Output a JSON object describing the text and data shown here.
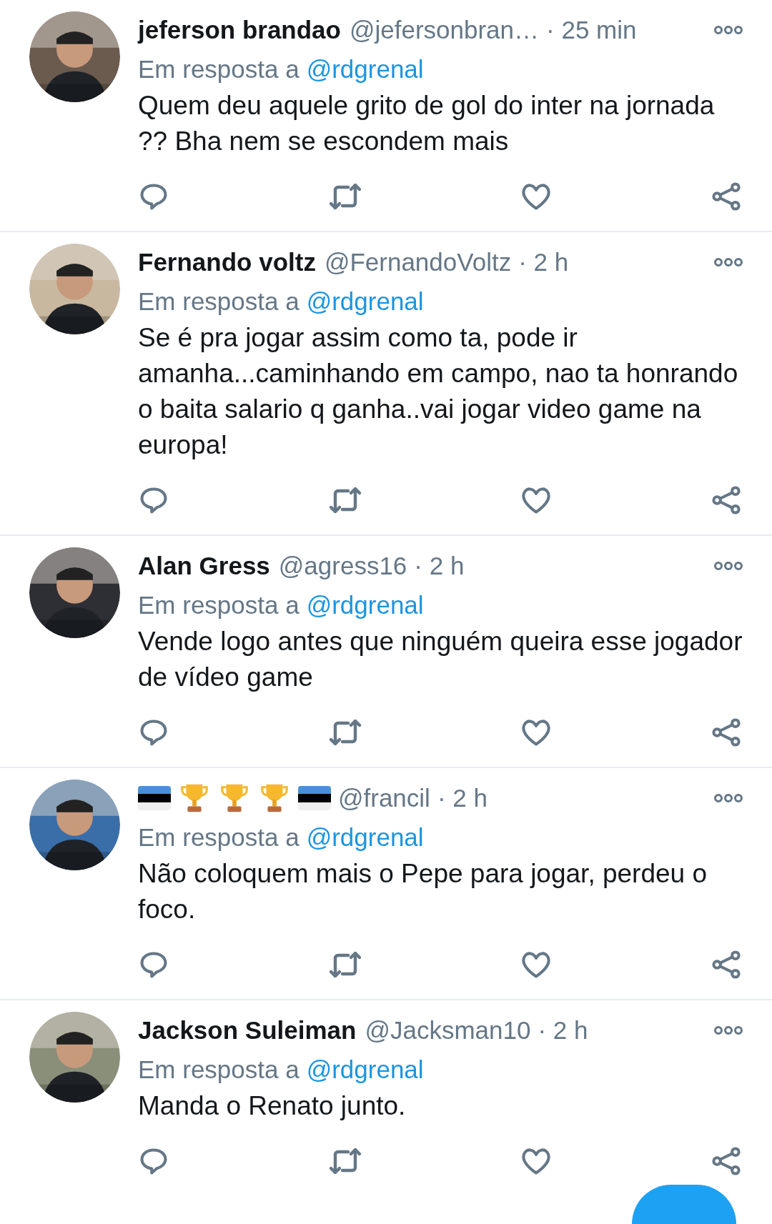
{
  "tweets": [
    {
      "name": "jeferson brandao",
      "handle": "@jefersonbran…",
      "time": "· 25 min",
      "reply_prefix": "Em resposta a",
      "reply_to": "@rdgrenal",
      "text": "Quem deu aquele grito de gol do inter na jornada ?? Bha nem se escondem mais"
    },
    {
      "name": "Fernando voltz",
      "handle": "@FernandoVoltz",
      "time": "· 2 h",
      "reply_prefix": "Em resposta a",
      "reply_to": "@rdgrenal",
      "text": "Se é pra jogar assim como ta, pode ir amanha...caminhando em campo, nao ta honrando o baita salario q ganha..vai jogar video game na europa!"
    },
    {
      "name": "Alan Gress",
      "handle": "@agress16",
      "time": "· 2 h",
      "reply_prefix": "Em resposta a",
      "reply_to": "@rdgrenal",
      "text": "Vende logo antes que ninguém queira esse jogador de vídeo game"
    },
    {
      "name_badges": [
        {
          "kind": "flag"
        },
        {
          "kind": "trophy"
        },
        {
          "kind": "trophy"
        },
        {
          "kind": "trophy"
        },
        {
          "kind": "flag"
        }
      ],
      "handle": "@francil",
      "time": "· 2 h",
      "reply_prefix": "Em resposta a",
      "reply_to": "@rdgrenal",
      "text": "Não coloquem mais o Pepe para jogar, perdeu o foco."
    },
    {
      "name": "Jackson Suleiman",
      "handle": "@Jacksman10",
      "time": "· 2 h",
      "reply_prefix": "Em resposta a",
      "reply_to": "@rdgrenal",
      "text": "Manda o Renato junto."
    }
  ]
}
